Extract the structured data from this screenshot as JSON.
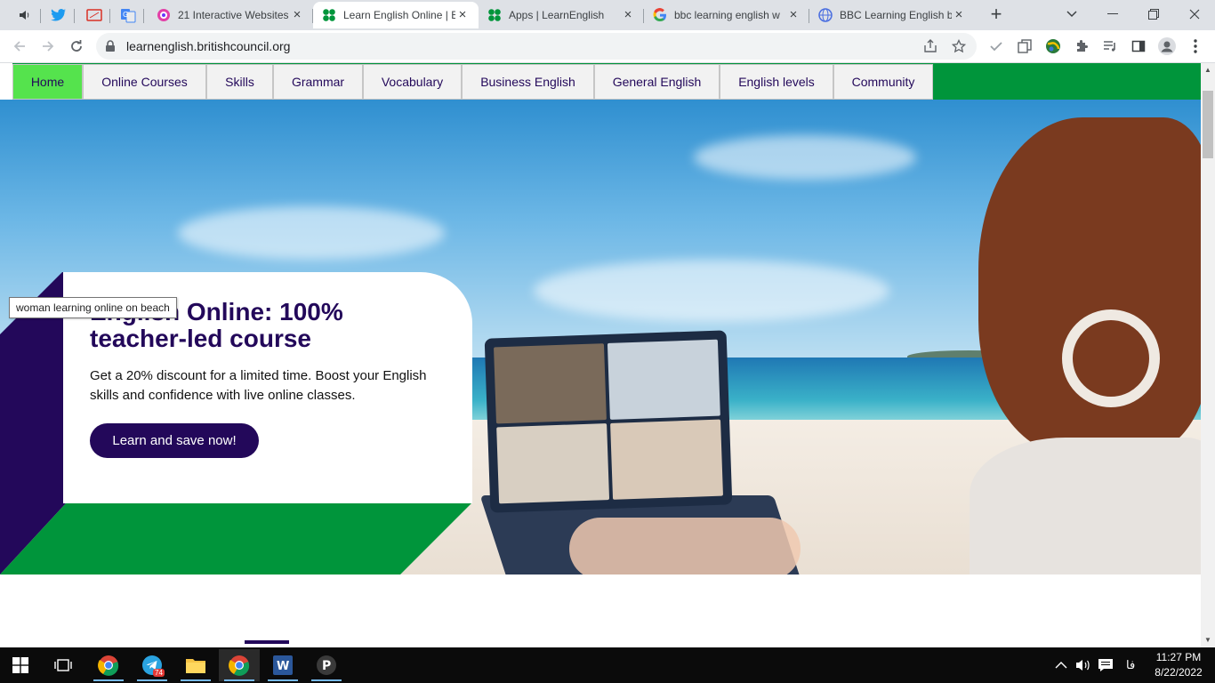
{
  "browser": {
    "tabs": [
      {
        "title": "21 Interactive Websites",
        "active": false
      },
      {
        "title": "Learn English Online | B",
        "active": true
      },
      {
        "title": "Apps | LearnEnglish",
        "active": false
      },
      {
        "title": "bbc learning english w",
        "active": false
      },
      {
        "title": "BBC Learning English b",
        "active": false
      }
    ],
    "url": "learnenglish.britishcouncil.org"
  },
  "site_nav": {
    "items": [
      "Home",
      "Online Courses",
      "Skills",
      "Grammar",
      "Vocabulary",
      "Business English",
      "General English",
      "English levels",
      "Community"
    ]
  },
  "hero": {
    "title": "English Online: 100% teacher-led course",
    "body": "Get a 20% discount for a limited time. Boost your English skills and confidence with live online classes.",
    "cta": "Learn and save now!",
    "image_tooltip": "woman learning online on beach"
  },
  "taskbar": {
    "telegram_badge": "74",
    "time": "11:27 PM",
    "date": "8/22/2022",
    "lang": "فا"
  },
  "colors": {
    "brand_purple": "#23085a",
    "brand_green": "#00953b",
    "nav_active": "#55e34d"
  }
}
